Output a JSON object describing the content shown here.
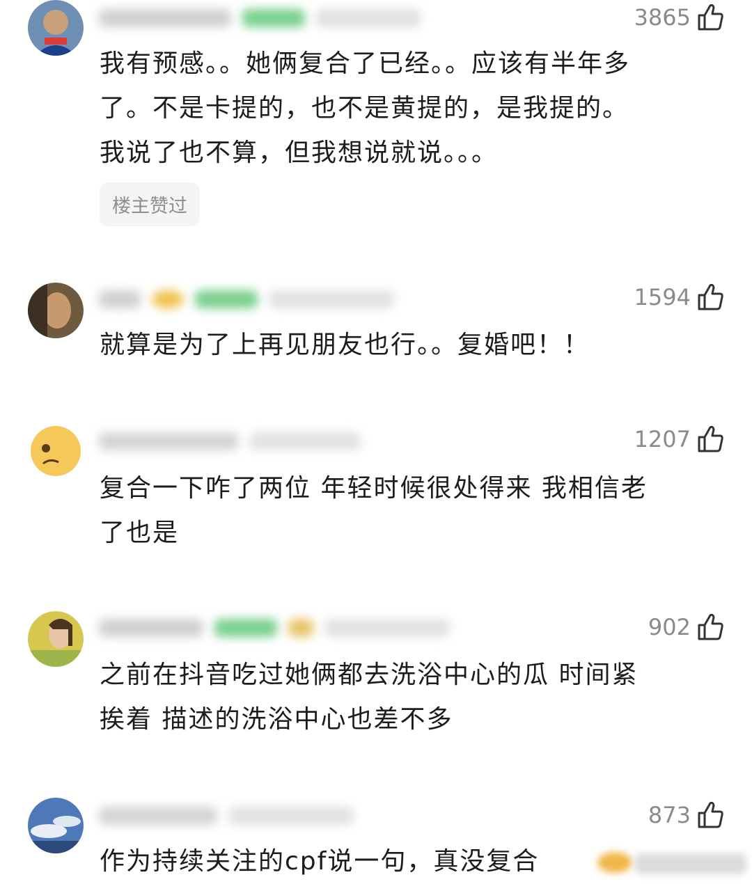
{
  "comments": [
    {
      "likes": "3865",
      "text_lines": [
        "我有预感。。她俩复合了已经。。应该有半年多",
        "了。不是卡提的，也不是黄提的，是我提的。",
        "我说了也不算，但我想说就说。。。"
      ],
      "badge": "楼主赞过"
    },
    {
      "likes": "1594",
      "text_lines": [
        "就算是为了上再见朋友也行。。复婚吧！！"
      ]
    },
    {
      "likes": "1207",
      "text_lines": [
        "复合一下咋了两位 年轻时候很处得来 我相信老",
        "了也是"
      ]
    },
    {
      "likes": "902",
      "text_lines": [
        "之前在抖音吃过她俩都去洗浴中心的瓜 时间紧",
        "挨着 描述的洗浴中心也差不多"
      ]
    },
    {
      "likes": "873",
      "text_lines": [
        "作为持续关注的cpf说一句，真没复合"
      ]
    }
  ],
  "icons": {
    "like": "thumbs-up-icon"
  },
  "colors": {
    "text": "#1c1c1c",
    "meta": "#8a8a8a",
    "badge_bg": "#f4f4f4",
    "vip_green": "#3dbb5b"
  }
}
